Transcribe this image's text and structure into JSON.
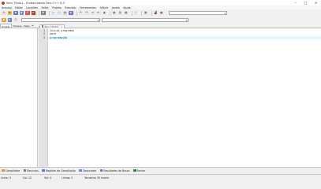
{
  "window": {
    "title": "Sem Título1 - Embarcadero Dev-C++ 6.3",
    "controls": {
      "minimize": "–",
      "maximize": "□",
      "close": "✕"
    }
  },
  "menu": [
    "Arquivo",
    "Editar",
    "Localizar",
    "Exibir",
    "Projeto",
    "Executar",
    "Ferramentas",
    "AStyle",
    "Janela",
    "Ajuda"
  ],
  "toolbar1": {
    "buttons": [
      {
        "name": "new-file-icon",
        "glyph": "▫",
        "bg": "#e4e4e4",
        "fg": "#555555"
      },
      {
        "name": "open-file-icon",
        "glyph": "▪",
        "bg": "#f2c04a",
        "fg": "#8a5a00"
      },
      {
        "name": "save-icon",
        "glyph": "▪",
        "bg": "#5b7fc4",
        "fg": "#ffffff"
      },
      {
        "name": "save-all-icon",
        "glyph": "▪",
        "bg": "#6b8fd4",
        "fg": "#ffffff"
      },
      {
        "name": "close-file-icon",
        "glyph": "✕",
        "bg": "#d9534f",
        "fg": "#ffffff"
      },
      {
        "name": "close-all-icon",
        "glyph": "✕",
        "bg": "#c9302c",
        "fg": "#ffffff"
      },
      {
        "sep": true
      },
      {
        "name": "print-icon",
        "glyph": "▤",
        "bg": "#7a7a7a",
        "fg": "#ffffff"
      },
      {
        "sep": true
      },
      {
        "name": "find-icon",
        "glyph": "⌕",
        "bg": "#dfe9f5",
        "fg": "#2a4f8a"
      },
      {
        "name": "replace-icon",
        "glyph": "⌕",
        "bg": "#dfe9f5",
        "fg": "#2a4f8a"
      },
      {
        "name": "goto-line-icon",
        "glyph": "≡",
        "bg": "#d8d8d8",
        "fg": "#333333"
      },
      {
        "name": "bookmark-icon",
        "glyph": "▪",
        "bg": "#7c6bd0",
        "fg": "#ffffff"
      },
      {
        "sep": true
      },
      {
        "name": "undo-icon",
        "glyph": "↶",
        "bg": "#e8e8e8",
        "fg": "#333333"
      },
      {
        "name": "redo-icon",
        "glyph": "↷",
        "bg": "#e8e8e8",
        "fg": "#333333"
      },
      {
        "name": "indent-icon",
        "glyph": "⇥",
        "bg": "#e8e8e8",
        "fg": "#333333"
      },
      {
        "name": "unindent-icon",
        "glyph": "⇤",
        "bg": "#e8e8e8",
        "fg": "#333333"
      },
      {
        "name": "toggle-comment-icon",
        "glyph": "◆",
        "bg": "#e8e8e8",
        "fg": "#444444"
      },
      {
        "sep": true
      },
      {
        "name": "grid-view-icon",
        "glyph": "▦",
        "bg": "#e8e8e8",
        "fg": "#555555"
      },
      {
        "name": "split-view-icon",
        "glyph": "▥",
        "bg": "#e8e8e8",
        "fg": "#555555"
      },
      {
        "name": "layout-icon",
        "glyph": "▦",
        "bg": "#e8e8e8",
        "fg": "#555555"
      },
      {
        "sep": true
      },
      {
        "name": "check-syntax-icon",
        "glyph": "✓",
        "bg": "#e8e8e8",
        "fg": "#2e7d32"
      },
      {
        "sep": true
      },
      {
        "name": "compile-settings-icon",
        "glyph": "▦",
        "bg": "#e8e8e8",
        "fg": "#555555"
      },
      {
        "sep": true
      },
      {
        "name": "profile-icon",
        "glyph": "▟",
        "bg": "#e8e8e8",
        "fg": "#555555"
      },
      {
        "name": "stop-icon",
        "glyph": "●",
        "bg": "#e8e8e8",
        "fg": "#c0392b"
      }
    ],
    "combo": {
      "value": ""
    }
  },
  "toolbar2": {
    "buttons": [
      {
        "name": "project-options-icon",
        "glyph": "▪",
        "bg": "#e6a23c",
        "fg": "#ffffff"
      },
      {
        "name": "class-browser-icon",
        "glyph": "◐",
        "bg": "#5b7fc4",
        "fg": "#ffffff"
      },
      {
        "name": "help-icon",
        "glyph": "?",
        "bg": "#e8e8e8",
        "fg": "#333333"
      }
    ],
    "combo1": {
      "value": ""
    },
    "combo2": {
      "value": ""
    }
  },
  "left_tabs": [
    "Projeto",
    "Classes",
    "Depu"
  ],
  "left_tabs_arrows": "◂▸",
  "editor": {
    "tab_label": "Sem Título1",
    "tab_close": "x",
    "line_numbers": [
      "1",
      "2",
      "3"
    ],
    "lines": [
      "Inicio programa",
      "pare",
      "programação"
    ]
  },
  "bottom_tabs": [
    {
      "name": "tab-compilador",
      "label": "Compilador",
      "icon": "#c9a227"
    },
    {
      "name": "tab-recursos",
      "label": "Recursos",
      "icon": "#7a7a7a"
    },
    {
      "name": "tab-registro-compilacao",
      "label": "Registro de Compilação",
      "icon": "#5b7fc4"
    },
    {
      "name": "tab-depurador",
      "label": "Depurador",
      "icon": "#5b8cc9"
    },
    {
      "name": "tab-resultados-busca",
      "label": "Resultados de Busca",
      "icon": "#4a7fc1"
    },
    {
      "name": "tab-fechar",
      "label": "Fechar",
      "icon": "#2e7d32"
    }
  ],
  "status": {
    "linha_label": "Linha:",
    "linha": "3",
    "col_label": "Col:",
    "col": "12",
    "sel_label": "Sel:",
    "sel": "0",
    "linhas_label": "Linhas:",
    "linhas": "3",
    "tamanho_label": "Tamanho:",
    "tamanho": "35 Inserir"
  }
}
